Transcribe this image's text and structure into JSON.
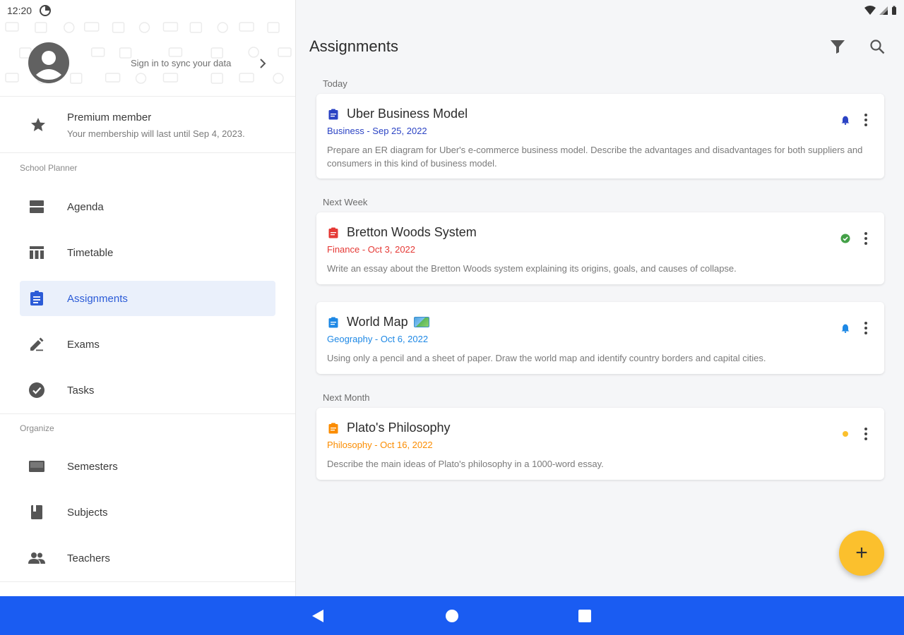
{
  "status_bar": {
    "time": "12:20"
  },
  "drawer": {
    "sign_in_text": "Sign in to sync your data",
    "premium": {
      "title": "Premium member",
      "subtitle": "Your membership will last until Sep 4, 2023."
    },
    "sections": [
      {
        "label": "School Planner",
        "items": [
          {
            "label": "Agenda",
            "icon": "agenda-icon"
          },
          {
            "label": "Timetable",
            "icon": "timetable-icon"
          },
          {
            "label": "Assignments",
            "icon": "assignments-icon",
            "active": true
          },
          {
            "label": "Exams",
            "icon": "pencil-icon"
          },
          {
            "label": "Tasks",
            "icon": "check-circle-icon"
          }
        ]
      },
      {
        "label": "Organize",
        "items": [
          {
            "label": "Semesters",
            "icon": "semesters-icon"
          },
          {
            "label": "Subjects",
            "icon": "book-icon"
          },
          {
            "label": "Teachers",
            "icon": "people-icon"
          }
        ]
      }
    ],
    "accent_color": "#2b5bd7"
  },
  "main": {
    "title": "Assignments",
    "groups": [
      {
        "label": "Today",
        "cards": [
          {
            "title": "Uber Business Model",
            "meta": "Business - Sep 25, 2022",
            "color": "#2b43c4",
            "description": "Prepare an ER diagram for Uber's e-commerce business model. Describe the advantages and disadvantages for both suppliers and consumers in this kind of business model.",
            "status_icon": "bell-icon"
          }
        ]
      },
      {
        "label": "Next Week",
        "cards": [
          {
            "title": "Bretton Woods System",
            "meta": "Finance - Oct 3, 2022",
            "color": "#e53935",
            "description": "Write an essay about the Bretton Woods system explaining its origins, goals, and causes of collapse.",
            "status_icon": "check-circle-icon"
          },
          {
            "title": "World Map",
            "meta": "Geography - Oct 6, 2022",
            "color": "#1e88e5",
            "description": "Using only a pencil and a sheet of paper. Draw the world map and identify country borders and capital cities.",
            "status_icon": "bell-icon"
          }
        ]
      },
      {
        "label": "Next Month",
        "cards": [
          {
            "title": "Plato's Philosophy",
            "meta": "Philosophy - Oct 16, 2022",
            "color": "#fb8c00",
            "description": "Describe the main ideas of Plato's philosophy in a 1000-word essay.",
            "status_icon": "dot-icon"
          }
        ]
      }
    ],
    "fab_label": "+",
    "fab_color": "#fbc02d"
  },
  "navbar_color": "#1a5cf2"
}
